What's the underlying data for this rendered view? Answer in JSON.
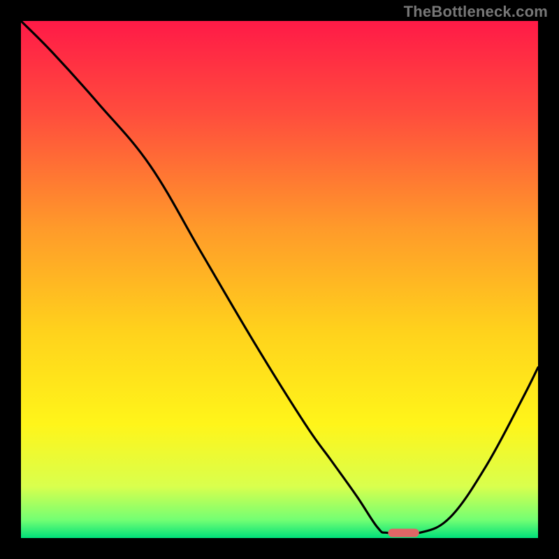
{
  "watermark": "TheBottleneck.com",
  "chart_data": {
    "type": "line",
    "title": "",
    "xlabel": "",
    "ylabel": "",
    "xlim": [
      0,
      100
    ],
    "ylim": [
      0,
      100
    ],
    "grid": false,
    "legend": false,
    "background_gradient_stops": [
      {
        "pos": 0.0,
        "color": "#ff1a47"
      },
      {
        "pos": 0.18,
        "color": "#ff4d3d"
      },
      {
        "pos": 0.4,
        "color": "#ff9a2a"
      },
      {
        "pos": 0.6,
        "color": "#ffd21c"
      },
      {
        "pos": 0.78,
        "color": "#fff51a"
      },
      {
        "pos": 0.9,
        "color": "#d9ff4d"
      },
      {
        "pos": 0.965,
        "color": "#73ff73"
      },
      {
        "pos": 1.0,
        "color": "#00e07a"
      }
    ],
    "series": [
      {
        "name": "bottleneck-curve",
        "x": [
          0,
          6,
          15,
          25,
          35,
          45,
          55,
          60,
          65,
          69,
          71,
          77,
          83,
          90,
          97,
          100
        ],
        "y": [
          100,
          94,
          84,
          72,
          55,
          38,
          22,
          15,
          8,
          2,
          1,
          1,
          4,
          14,
          27,
          33
        ]
      }
    ],
    "marker": {
      "name": "optimal-segment",
      "x_start": 71,
      "x_end": 77,
      "y": 1,
      "color": "#e06666"
    }
  }
}
